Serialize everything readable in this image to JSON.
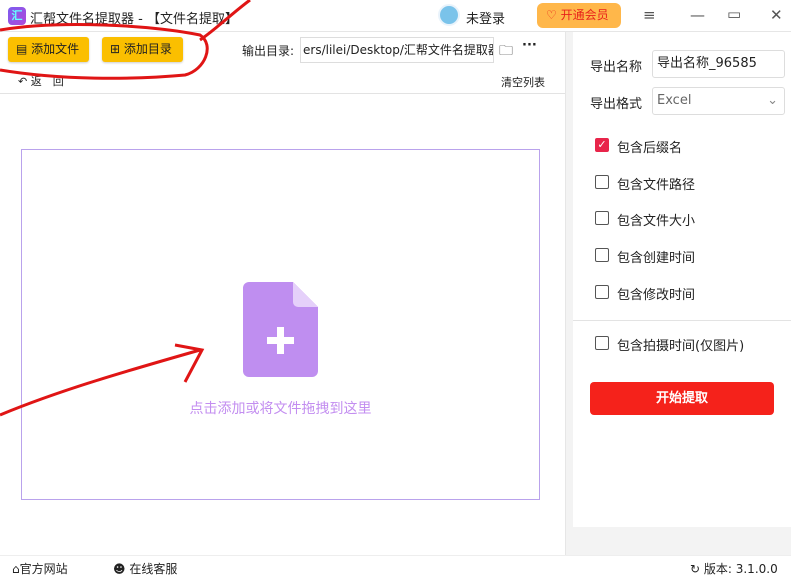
{
  "titlebar": {
    "title": "汇帮文件名提取器 - 【文件名提取】",
    "user": "未登录",
    "vip": "开通会员"
  },
  "toolbar": {
    "add_file": "添加文件",
    "add_dir": "添加目录",
    "output_label": "输出目录:",
    "output_path": "ers/lilei/Desktop/汇帮文件名提取器",
    "back": "返　回",
    "clear": "清空列表"
  },
  "drop": {
    "hint": "点击添加或将文件拖拽到这里"
  },
  "settings": {
    "name_label": "导出名称",
    "name_value": "导出名称_96585",
    "format_label": "导出格式",
    "format_value": "Excel",
    "options": [
      {
        "label": "包含后缀名",
        "checked": true
      },
      {
        "label": "包含文件路径",
        "checked": false
      },
      {
        "label": "包含文件大小",
        "checked": false
      },
      {
        "label": "包含创建时间",
        "checked": false
      },
      {
        "label": "包含修改时间",
        "checked": false
      },
      {
        "label": "包含拍摄时间(仅图片)",
        "checked": false
      }
    ],
    "start": "开始提取"
  },
  "footer": {
    "website": "官方网站",
    "support": "在线客服",
    "version": "版本: 3.1.0.0"
  },
  "colors": {
    "accent": "#fbbf00",
    "primary": "#f5221b",
    "drop": "#c38ef0"
  }
}
